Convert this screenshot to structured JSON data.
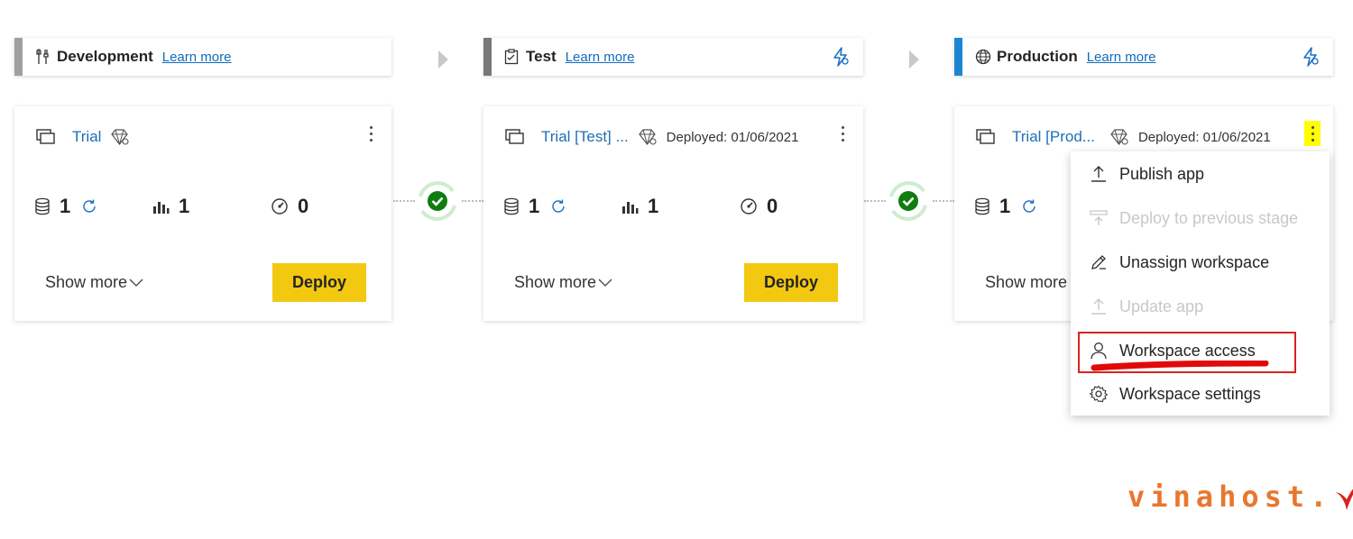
{
  "stages": [
    {
      "name": "Development",
      "learn_more": "Learn more",
      "color": "#a19f9d"
    },
    {
      "name": "Test",
      "learn_more": "Learn more",
      "color": "#777777"
    },
    {
      "name": "Production",
      "learn_more": "Learn more",
      "color": "#1a86d3"
    }
  ],
  "cards": [
    {
      "workspace": "Trial",
      "deployed": "",
      "datasets": "1",
      "reports": "1",
      "dashboards": "0",
      "show_more": "Show more",
      "deploy": "Deploy"
    },
    {
      "workspace": "Trial [Test] ...",
      "deployed": "Deployed: 01/06/2021",
      "datasets": "1",
      "reports": "1",
      "dashboards": "0",
      "show_more": "Show more",
      "deploy": "Deploy"
    },
    {
      "workspace": "Trial [Prod...",
      "deployed": "Deployed: 01/06/2021",
      "datasets": "1",
      "show_more": "Show more"
    }
  ],
  "menu": {
    "items": [
      {
        "label": "Publish app",
        "enabled": true
      },
      {
        "label": "Deploy to previous stage",
        "enabled": false
      },
      {
        "label": "Unassign workspace",
        "enabled": true
      },
      {
        "label": "Update app",
        "enabled": false
      },
      {
        "label": "Workspace access",
        "enabled": true,
        "highlighted": true
      },
      {
        "label": "Workspace settings",
        "enabled": true
      }
    ]
  },
  "logo": {
    "text": "vinahost."
  },
  "colors": {
    "accent_yellow": "#f2c811",
    "link_blue": "#1f6fb5",
    "success_green": "#107c10",
    "highlight_red": "#d9221f",
    "logo_orange": "#e8772e"
  }
}
